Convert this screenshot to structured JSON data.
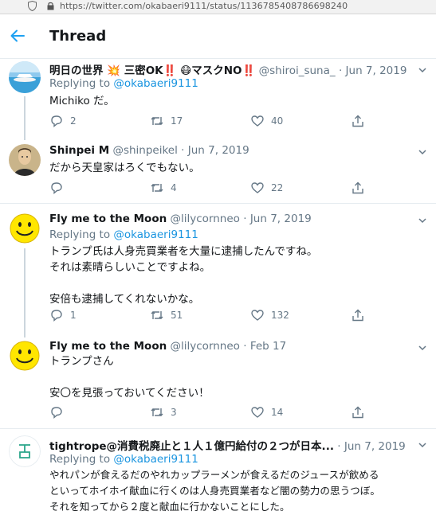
{
  "browser": {
    "url": "https://twitter.com/okabaeri9111/status/1136785408786698240"
  },
  "header": {
    "title": "Thread"
  },
  "colors": {
    "accent": "#1da1f2",
    "mention": "#1b95e0",
    "secondary_text": "#657786",
    "thread_line": "#ccd6dd"
  },
  "tweets": [
    {
      "name": "明日の世界 💥 三密OK‼️ 😷マスクNO‼️",
      "handle": "@shiroi_suna_",
      "date": "Jun 7, 2019",
      "replying_label": "Replying to",
      "replying_to": "@okabaeri9111",
      "text": "Michiko だ。",
      "counts": {
        "reply": "2",
        "retweet": "17",
        "like": "40"
      },
      "avatar": "beach-avatar"
    },
    {
      "name": "Shinpei M",
      "handle": "@shinpeikel",
      "date": "Jun 7, 2019",
      "text": "だから天皇家はろくでもない。",
      "counts": {
        "reply": "",
        "retweet": "4",
        "like": "22"
      },
      "avatar": "portrait-avatar"
    },
    {
      "name": "Fly me to the Moon",
      "handle": "@lilycornneo",
      "date": "Jun 7, 2019",
      "replying_label": "Replying to",
      "replying_to": "@okabaeri9111",
      "text": "トランプ氏は人身売買業者を大量に逮捕したんですね。\nそれは素晴らしいことですよね。\n\n安倍も逮捕してくれないかな。",
      "counts": {
        "reply": "1",
        "retweet": "51",
        "like": "132"
      },
      "avatar": "smiley-avatar"
    },
    {
      "name": "Fly me to the Moon",
      "handle": "@lilycornneo",
      "date": "Feb 17",
      "text": "トランプさん\n\n安〇を見張っておいてください！",
      "counts": {
        "reply": "",
        "retweet": "3",
        "like": "14"
      },
      "avatar": "smiley-avatar"
    },
    {
      "name": "tightrope@消費税廃止と１人１億円給付の２つが日本...",
      "handle": "",
      "date": "Jun 7, 2019",
      "replying_label": "Replying to",
      "replying_to": "@okabaeri9111",
      "text": "やれパンが食えるだのやれカップラーメンが食えるだのジュースが飲める\nといってホイホイ献血に行くのは人身売買業者など闇の勢力の思うつぼ。\nそれを知ってから２度と献血に行かないことにした。",
      "counts": {
        "reply": "",
        "retweet": "",
        "like": ""
      },
      "avatar": "kanji-avatar"
    }
  ]
}
